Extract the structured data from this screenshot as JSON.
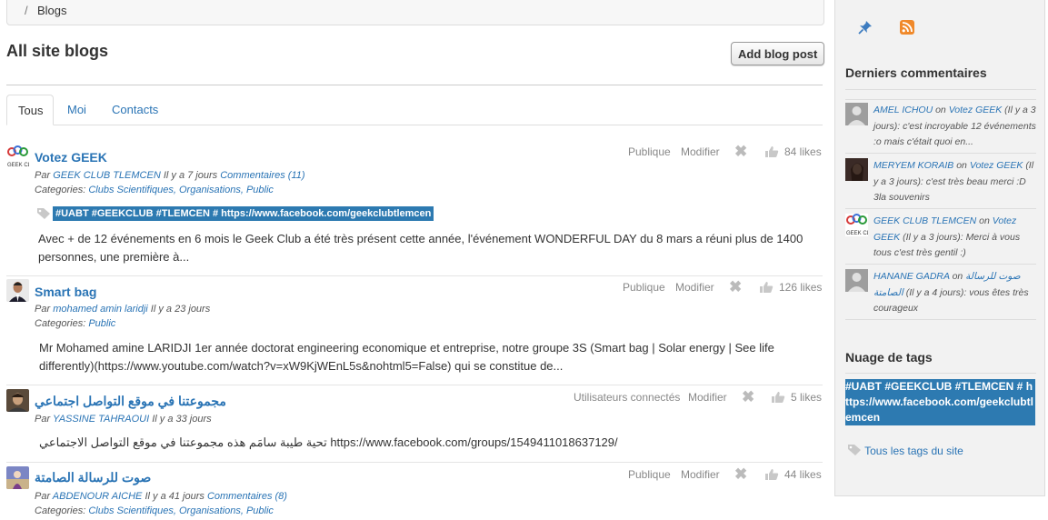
{
  "breadcrumb": {
    "separator": "/",
    "current": "Blogs"
  },
  "page_title": "All site blogs",
  "add_button": "Add blog post",
  "tabs": [
    {
      "label": "Tous"
    },
    {
      "label": "Moi"
    },
    {
      "label": "Contacts"
    }
  ],
  "posts": [
    {
      "title": "Votez GEEK",
      "by": "Par",
      "author": "GEEK CLUB TLEMCEN",
      "time": "Il y a 7 jours",
      "comments": "Commentaires (11)",
      "categories_label": "Categories:",
      "categories": "Clubs Scientifiques, Organisations, Public",
      "tag": "#UABT #GEEKCLUB #TLEMCEN # https://www.facebook.com/geekclubtlemcen",
      "access": "Publique",
      "edit": "Modifier",
      "likes": "84 likes",
      "excerpt": "Avec + de 12 événements en 6 mois le Geek Club a été très présent cette année, l'événement WONDERFUL DAY du 8 mars a réuni plus de 1400 personnes, une première à..."
    },
    {
      "title": "Smart bag",
      "by": "Par",
      "author": "mohamed amin laridji",
      "time": "Il y a 23 jours",
      "categories_label": "Categories:",
      "categories": "Public",
      "access": "Publique",
      "edit": "Modifier",
      "likes": "126 likes",
      "excerpt": "Mr Mohamed amine LARIDJI 1er année doctorat engineering economique et entreprise, notre groupe 3S (Smart bag | Solar energy | See life differently)(https://www.youtube.com/watch?v=xW9KjWEnL5s&nohtml5=False) qui se constitue de..."
    },
    {
      "title": "مجموعتنا في موقع التواصل اجتماعي",
      "by": "Par",
      "author": "YASSINE TAHRAOUI",
      "time": "Il y a 33 jours",
      "access": "Utilisateurs connectés",
      "edit": "Modifier",
      "likes": "5 likes",
      "excerpt": "تحية طيبة سامَم هذه مجموعتنا في موقع التواصل الاجتماعي https://www.facebook.com/groups/1549411018637129/"
    },
    {
      "title": "صوت للرسالة الصامتة",
      "by": "Par",
      "author": "ABDENOUR AICHE",
      "time": "Il y a 41 jours",
      "comments": "Commentaires (8)",
      "categories_label": "Categories:",
      "categories": "Clubs Scientifiques, Organisations, Public",
      "access": "Publique",
      "edit": "Modifier",
      "likes": "44 likes"
    }
  ],
  "sidebar": {
    "comments_heading": "Derniers commentaires",
    "comments": [
      {
        "author": "AMEL ICHOU",
        "on": "on",
        "post": "Votez GEEK",
        "time": "(Il y a 3 jours):",
        "text": "c'est incroyable 12 événements :o mais c'était quoi en..."
      },
      {
        "author": "MERYEM KORAIB",
        "on": "on",
        "post": "Votez GEEK",
        "time": "(Il y a 3 jours):",
        "text": "c'est très beau merci :D 3la souvenirs"
      },
      {
        "author": "GEEK CLUB TLEMCEN",
        "on": "on",
        "post": "Votez GEEK",
        "time": "(Il y a 3 jours):",
        "text": "Merci à vous tous c'est très gentil :)"
      },
      {
        "author": "HANANE GADRA",
        "on": "on",
        "post": "صوت للرسالة الصامتة",
        "time": "(Il y a 4 jours):",
        "text": "vous êtes très courageux"
      }
    ],
    "tags_heading": "Nuage de tags",
    "tag_cloud": "#UABT #GEEKCLUB #TLEMCEN # https://www.facebook.com/geekclubtlemcen",
    "all_tags_link": "Tous les tags du site"
  },
  "colors": {
    "link": "#2a74b5",
    "tag_background": "#2d7ab1"
  }
}
